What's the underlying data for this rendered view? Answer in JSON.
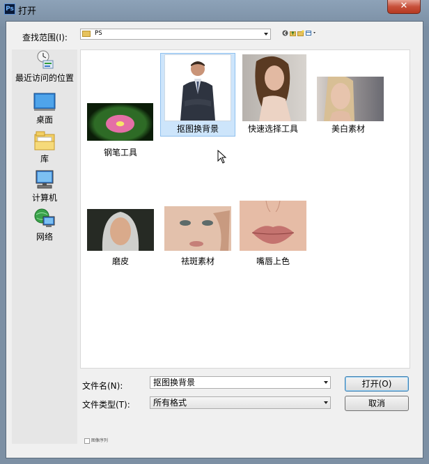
{
  "window": {
    "title": "打开",
    "app_icon_text": "Ps",
    "close_symbol": "✕"
  },
  "lookin": {
    "label": "查找范围(I):",
    "value": "PS"
  },
  "toolbar_icons": [
    "back-icon",
    "up-folder-icon",
    "new-folder-icon",
    "view-menu-icon"
  ],
  "places": [
    {
      "label": "最近访问的位置",
      "icon": "recent-places-icon"
    },
    {
      "label": "桌面",
      "icon": "desktop-icon"
    },
    {
      "label": "库",
      "icon": "libraries-icon"
    },
    {
      "label": "计算机",
      "icon": "computer-icon"
    },
    {
      "label": "网络",
      "icon": "network-icon"
    }
  ],
  "files": [
    {
      "label": "钢笔工具",
      "selected": false
    },
    {
      "label": "抠图换背景",
      "selected": true
    },
    {
      "label": "快速选择工具",
      "selected": false
    },
    {
      "label": "美白素材",
      "selected": false
    },
    {
      "label": "磨皮",
      "selected": false
    },
    {
      "label": "祛斑素材",
      "selected": false
    },
    {
      "label": "嘴唇上色",
      "selected": false
    }
  ],
  "filename": {
    "label": "文件名(N):",
    "value": "抠图换背景"
  },
  "filetype": {
    "label": "文件类型(T):",
    "value": "所有格式"
  },
  "buttons": {
    "open": "打开(O)",
    "cancel": "取消"
  },
  "sequence_checkbox": {
    "label": "图像序列",
    "checked": false
  }
}
